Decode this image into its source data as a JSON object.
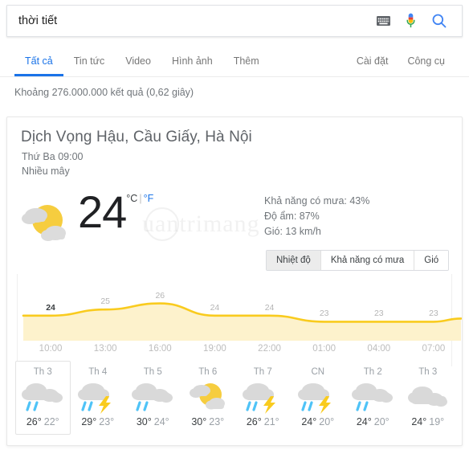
{
  "search": {
    "query": "thời tiết",
    "placeholder": "",
    "icons": [
      "keyboard-icon",
      "microphone-icon",
      "search-icon"
    ]
  },
  "nav": {
    "left_items": [
      {
        "label": "Tất cả",
        "active": true
      },
      {
        "label": "Tin tức",
        "active": false
      },
      {
        "label": "Video",
        "active": false
      },
      {
        "label": "Hình ảnh",
        "active": false
      },
      {
        "label": "Thêm",
        "active": false
      }
    ],
    "right_items": [
      {
        "label": "Cài đặt"
      },
      {
        "label": "Công cụ"
      }
    ]
  },
  "result_stats": "Khoảng 276.000.000 kết quả (0,62 giây)",
  "weather": {
    "location": "Dịch Vọng Hậu, Cầu Giấy, Hà Nội",
    "datetime": "Thứ Ba 09:00",
    "condition": "Nhiều mây",
    "temperature": "24",
    "unit_c": "°C",
    "unit_sep": "|",
    "unit_f": "°F",
    "watermark": "uantrimang",
    "current_icon": "partly-cloudy-icon",
    "stats": [
      "Khả năng có mưa: 43%",
      "Độ ẩm: 87%",
      "Gió: 13 km/h"
    ],
    "toggles": [
      {
        "label": "Nhiệt độ",
        "active": true
      },
      {
        "label": "Khả năng có mưa",
        "active": false
      },
      {
        "label": "Gió",
        "active": false
      }
    ],
    "forecast": [
      {
        "day": "Th 3",
        "icon": "rain-icon",
        "high": "26°",
        "low": "22°",
        "selected": true
      },
      {
        "day": "Th 4",
        "icon": "thunderstorm-icon",
        "high": "29°",
        "low": "23°",
        "selected": false
      },
      {
        "day": "Th 5",
        "icon": "rain-icon",
        "high": "30°",
        "low": "24°",
        "selected": false
      },
      {
        "day": "Th 6",
        "icon": "partly-sunny-icon",
        "high": "30°",
        "low": "23°",
        "selected": false
      },
      {
        "day": "Th 7",
        "icon": "thunderstorm-icon",
        "high": "26°",
        "low": "21°",
        "selected": false
      },
      {
        "day": "CN",
        "icon": "thunderstorm-icon",
        "high": "24°",
        "low": "20°",
        "selected": false
      },
      {
        "day": "Th 2",
        "icon": "rain-icon",
        "high": "24°",
        "low": "20°",
        "selected": false
      },
      {
        "day": "Th 3",
        "icon": "cloudy-icon",
        "high": "24°",
        "low": "19°",
        "selected": false
      }
    ]
  },
  "colors": {
    "accent_blue": "#1a73e8",
    "chart_line": "#f9cb1e",
    "chart_fill": "#fdf2cc",
    "sun_yellow": "#f6cd3f",
    "cloud_gray": "#d8d8d8",
    "rain_blue": "#4fc3f7"
  },
  "chart_data": {
    "type": "area",
    "title": "",
    "xlabel": "",
    "ylabel": "",
    "series_name": "Nhiệt độ",
    "categories": [
      "10:00",
      "13:00",
      "16:00",
      "19:00",
      "22:00",
      "01:00",
      "04:00",
      "07:00"
    ],
    "labels": [
      "24",
      "25",
      "26",
      "24",
      "24",
      "23",
      "23",
      "23"
    ],
    "values": [
      24,
      25,
      26,
      24,
      24,
      23,
      23,
      23
    ],
    "ylim": [
      22,
      27
    ],
    "grid": false,
    "legend": "none",
    "line_color": "#f9cb1e",
    "fill_color": "#fdf2cc",
    "highlight_index": 0
  }
}
